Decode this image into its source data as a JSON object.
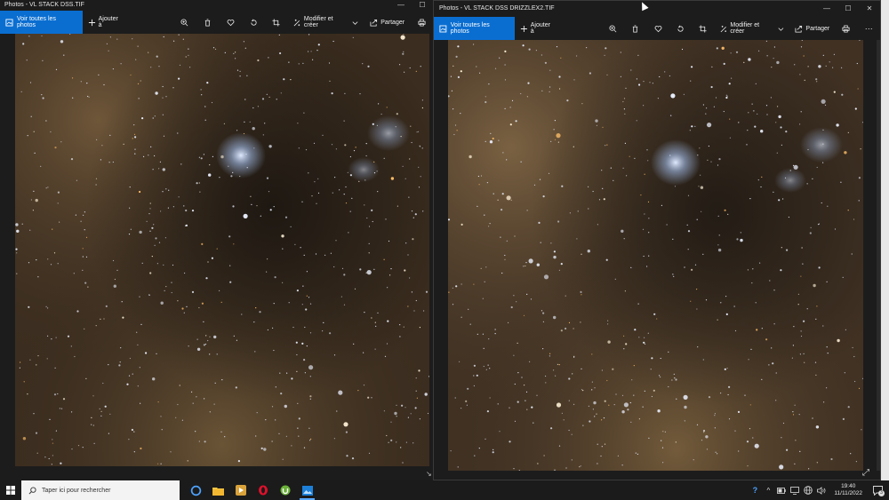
{
  "left_window": {
    "title": "Photos - VL STACK DSS.TIF",
    "toolbar": {
      "view_all_label": "Voir toutes les photos",
      "add_to_label": "Ajouter à",
      "edit_label": "Modifier et créer",
      "share_label": "Partager"
    }
  },
  "right_window": {
    "title": "Photos - VL STACK DSS DRIZZLEX2.TIF",
    "toolbar": {
      "view_all_label": "Voir toutes les photos",
      "add_to_label": "Ajouter à",
      "edit_label": "Modifier et créer",
      "share_label": "Partager",
      "more_label": "···"
    }
  },
  "taskbar": {
    "search_placeholder": "Taper ici pour rechercher",
    "time": "19:40",
    "date": "11/11/2022",
    "notification_count": "3"
  },
  "colors": {
    "accent": "#0a6ed1",
    "window_bg": "#1c1c1c",
    "taskbar_bg": "#1b1b1b"
  }
}
